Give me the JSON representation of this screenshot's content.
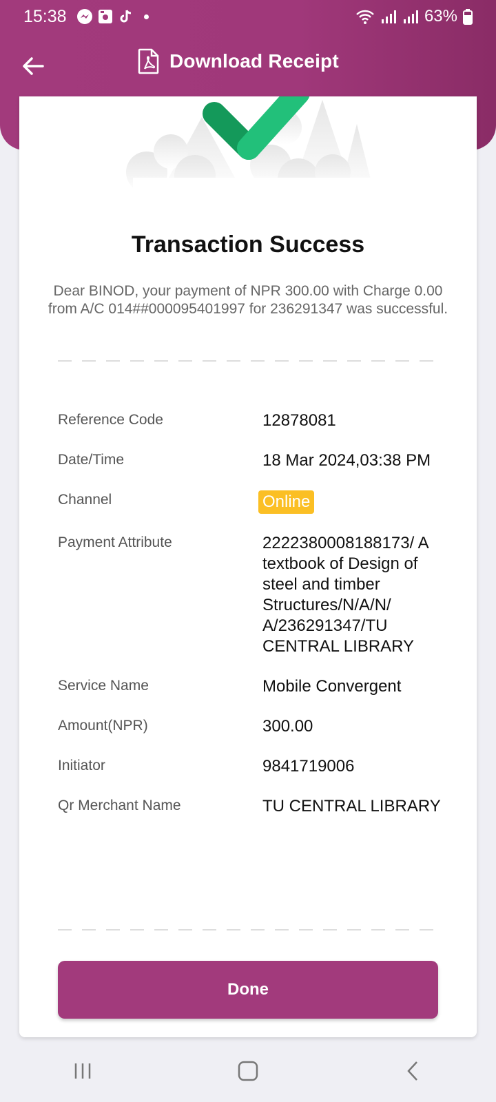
{
  "status_bar": {
    "time": "15:38",
    "battery": "63%"
  },
  "appbar": {
    "title": "Download Receipt"
  },
  "receipt": {
    "title": "Transaction Success",
    "message": "Dear BINOD, your payment of NPR 300.00 with Charge 0.00 from A/C 014##000095401997 for 236291347 was successful.",
    "rows": [
      {
        "label": "Reference Code",
        "value": "12878081"
      },
      {
        "label": "Date/Time",
        "value": "18 Mar 2024,03:38 PM"
      },
      {
        "label": "Channel",
        "value": "Online"
      },
      {
        "label": "Payment Attribute",
        "value": "2222380008188173/ A textbook of Design of steel and timber Structures/N/A/N/ A/236291347/TU CENTRAL LIBRARY"
      },
      {
        "label": "Service Name",
        "value": "Mobile Convergent"
      },
      {
        "label": "Amount(NPR)",
        "value": "300.00"
      },
      {
        "label": "Initiator",
        "value": "9841719006"
      },
      {
        "label": "Qr Merchant Name",
        "value": "TU CENTRAL LIBRARY"
      }
    ],
    "done_label": "Done"
  },
  "colors": {
    "primary": "#a23a7c",
    "badge": "#fbbf24",
    "success": "#22c07a"
  }
}
